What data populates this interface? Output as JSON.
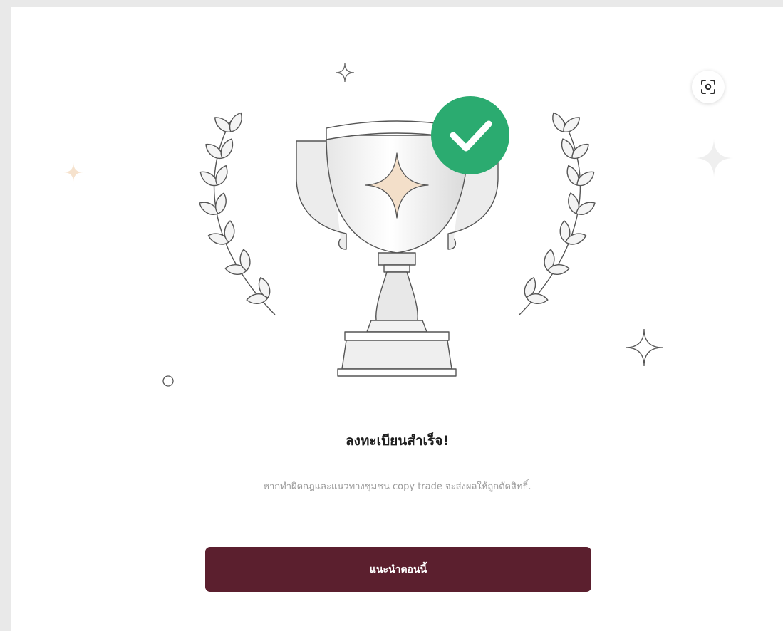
{
  "success": {
    "title": "ลงทะเบียนสำเร็จ!",
    "subtitle": "หากทำผิดกฎและแนวทางชุมชน copy trade จะส่งผลให้ถูกตัดสิทธิ์.",
    "cta_label": "แนะนำตอนนี้"
  },
  "icons": {
    "scan": "scan-icon",
    "trophy": "trophy-icon",
    "check": "check-icon",
    "laurel": "laurel-icon",
    "sparkle": "sparkle-icon"
  },
  "colors": {
    "accent": "#5b1f2e",
    "success": "#2bab70",
    "sparkle_warm": "#f3dfc9"
  }
}
